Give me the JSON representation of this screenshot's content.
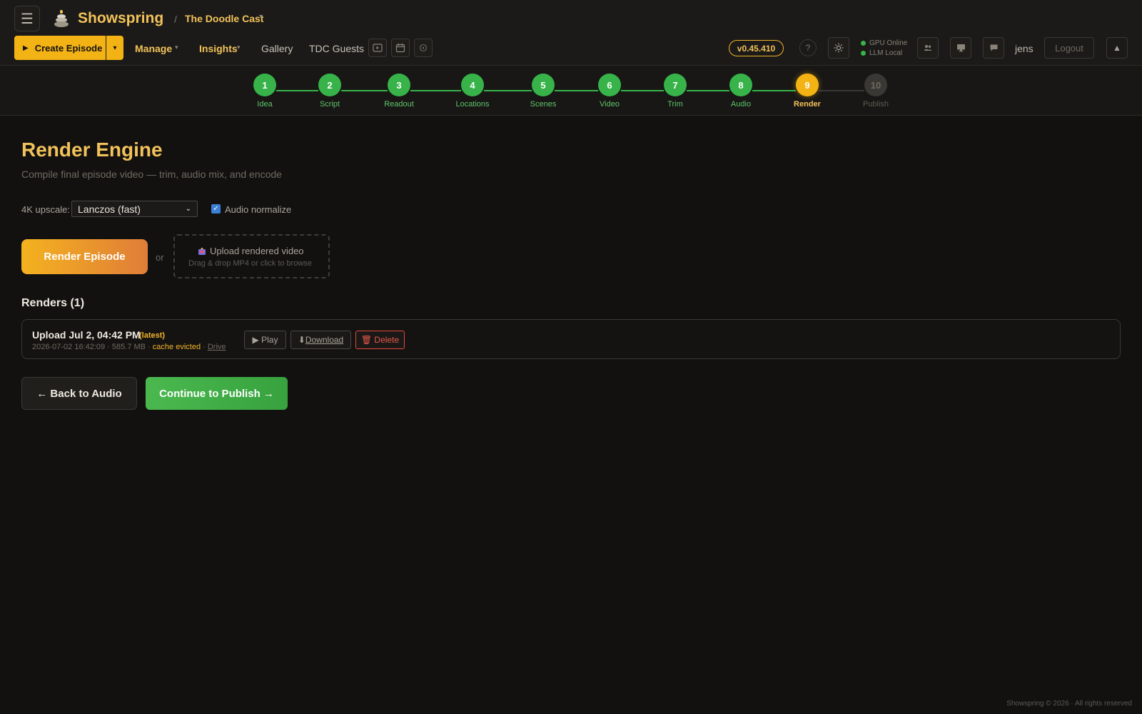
{
  "header": {
    "brand": "Showspring",
    "breadcrumb_sep": "/",
    "show_name": "The Doodle Cast",
    "create_label": "Create Episode",
    "nav": {
      "manage": "Manage",
      "insights": "Insights",
      "gallery": "Gallery",
      "guests": "TDC Guests"
    },
    "version": "v0.45.410",
    "help": "?",
    "status": {
      "gpu": "GPU Online",
      "llm": "LLM Local"
    },
    "user": "jens",
    "logout": "Logout",
    "colors": {
      "accent": "#f4b315",
      "brand_text": "#f2c25a",
      "success": "#37b34a"
    }
  },
  "stepper": {
    "steps": [
      {
        "num": "1",
        "label": "Idea",
        "state": "done"
      },
      {
        "num": "2",
        "label": "Script",
        "state": "done"
      },
      {
        "num": "3",
        "label": "Readout",
        "state": "done"
      },
      {
        "num": "4",
        "label": "Locations",
        "state": "done"
      },
      {
        "num": "5",
        "label": "Scenes",
        "state": "done"
      },
      {
        "num": "6",
        "label": "Video",
        "state": "done"
      },
      {
        "num": "7",
        "label": "Trim",
        "state": "done"
      },
      {
        "num": "8",
        "label": "Audio",
        "state": "done"
      },
      {
        "num": "9",
        "label": "Render",
        "state": "active"
      },
      {
        "num": "10",
        "label": "Publish",
        "state": "todo"
      }
    ]
  },
  "main": {
    "title": "Render Engine",
    "subtitle": "Compile final episode video — trim, audio mix, and encode",
    "upscale_label": "4K upscale:",
    "upscale_value": "Lanczos (fast)",
    "normalize_label": "Audio normalize",
    "normalize_checked": true,
    "render_button": "Render Episode",
    "or_text": "or",
    "upload_title": "Upload rendered video",
    "upload_hint": "Drag & drop MP4 or click to browse",
    "renders_heading": "Renders (1)",
    "renders": [
      {
        "title": "Upload Jul 2, 04:42 PM",
        "tag": "(latest)",
        "meta": "2026-07-02 16:42:09 · 585.7 MB ·",
        "cache": "cache evicted",
        "meta_sep": "·",
        "drive": "Drive",
        "play": "▶ Play",
        "download_icon": "⬇",
        "download": "Download",
        "delete": "🗑 Delete"
      }
    ],
    "back_button": "← Back to Audio",
    "continue_button": "Continue to Publish →"
  },
  "footer": "Showspring © 2026 · All rights reserved"
}
